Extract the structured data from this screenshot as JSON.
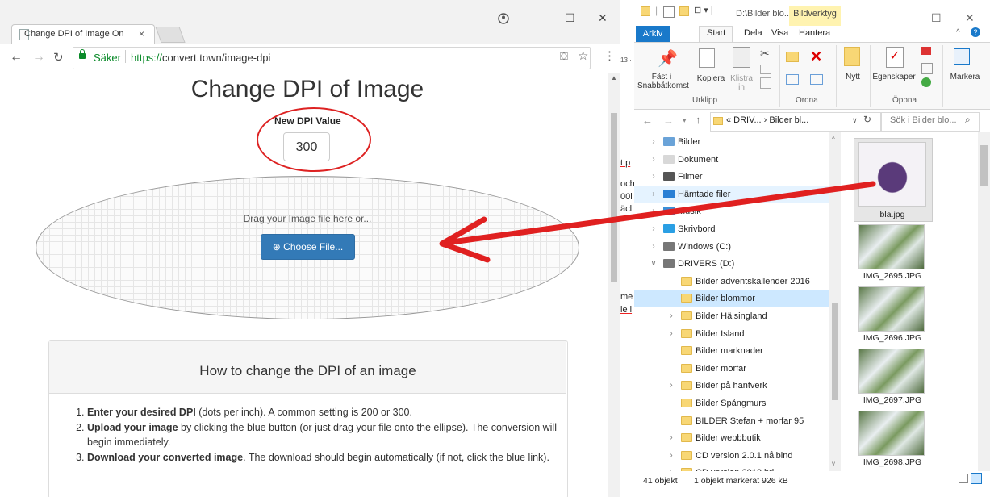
{
  "browser": {
    "tab_title": "Change DPI of Image On",
    "tab_close": "×",
    "window_controls": [
      "—",
      "☐",
      "✕"
    ],
    "secure_label": "Säker",
    "url_protocol": "https://",
    "url_rest": "convert.town/image-dpi",
    "page": {
      "title": "Change DPI of Image",
      "dpi_label": "New DPI Value",
      "dpi_value": "300",
      "drop_text": "Drag your Image file here or...",
      "choose_button": "Choose File...",
      "howto_title": "How to change the DPI of an image",
      "steps": [
        {
          "bold": "Enter your desired DPI",
          "rest": " (dots per inch). A common setting is 200 or 300."
        },
        {
          "bold": "Upload your image",
          "rest": " by clicking the blue button (or just drag your file onto the ellipse). The conversion will begin immediately."
        },
        {
          "bold": "Download your converted image",
          "rest": ". The download should begin automatically (if not, click the blue link)."
        }
      ]
    }
  },
  "middle_fragments": [
    "13 ·",
    "t p",
    "och",
    "00i",
    "äcl",
    "me",
    "ie i"
  ],
  "explorer": {
    "title_path": "D:\\Bilder blo...",
    "context_tab": "Bildverktyg",
    "window_controls": [
      "—",
      "☐",
      "✕"
    ],
    "ribbon_tabs": [
      "Arkiv",
      "Start",
      "Dela",
      "Visa",
      "Hantera"
    ],
    "ribbon_buttons": {
      "pin": "Fäst i Snabbåtkomst",
      "copy": "Kopiera",
      "paste": "Klistra in",
      "new": "Nytt",
      "properties": "Egenskaper",
      "select": "Markera"
    },
    "ribbon_groups": [
      "Urklipp",
      "Ordna",
      "Öppna"
    ],
    "address": "« DRIV... › Bilder bl...",
    "search_placeholder": "Sök i Bilder blo...",
    "tree": [
      {
        "label": "Bilder",
        "type": "lib",
        "expand": true
      },
      {
        "label": "Dokument",
        "type": "doc",
        "expand": true
      },
      {
        "label": "Filmer",
        "type": "film",
        "expand": true
      },
      {
        "label": "Hämtade filer",
        "type": "down",
        "expand": true
      },
      {
        "label": "Musik",
        "type": "music",
        "expand": true
      },
      {
        "label": "Skrivbord",
        "type": "desk",
        "expand": true
      },
      {
        "label": "Windows (C:)",
        "type": "drive",
        "expand": true
      },
      {
        "label": "DRIVERS (D:)",
        "type": "drive",
        "expand": false,
        "open": true
      },
      {
        "label": "Bilder adventskallender 2016",
        "type": "folder",
        "child": true,
        "expand": false
      },
      {
        "label": "Bilder blommor",
        "type": "folder",
        "child": true,
        "expand": false
      },
      {
        "label": "Bilder Hälsingland",
        "type": "folder",
        "child": true,
        "expand": true
      },
      {
        "label": "Bilder Island",
        "type": "folder",
        "child": true,
        "expand": true
      },
      {
        "label": "Bilder marknader",
        "type": "folder",
        "child": true,
        "expand": false
      },
      {
        "label": "Bilder morfar",
        "type": "folder",
        "child": true,
        "expand": false
      },
      {
        "label": "Bilder på hantverk",
        "type": "folder",
        "child": true,
        "expand": true
      },
      {
        "label": "Bilder Spångmurs",
        "type": "folder",
        "child": true,
        "expand": false
      },
      {
        "label": "BILDER Stefan + morfar 95",
        "type": "folder",
        "child": true,
        "expand": false
      },
      {
        "label": "Bilder webbbutik",
        "type": "folder",
        "child": true,
        "expand": true
      },
      {
        "label": "CD version 2.0.1 nålbind",
        "type": "folder",
        "child": true,
        "expand": true
      },
      {
        "label": "CD version 2012 bri...",
        "type": "folder",
        "child": true,
        "expand": true
      }
    ],
    "files": [
      {
        "name": "bla.jpg",
        "selected": true
      },
      {
        "name": "IMG_2695.JPG",
        "selected": false
      },
      {
        "name": "IMG_2696.JPG",
        "selected": false
      },
      {
        "name": "IMG_2697.JPG",
        "selected": false
      },
      {
        "name": "IMG_2698.JPG",
        "selected": false
      }
    ],
    "status_count": "41 objekt",
    "status_selected": "1 objekt markerat  926 kB"
  },
  "colors": {
    "accent_blue": "#337ab7",
    "annotation_red": "#e02020",
    "secure_green": "#0a8a29",
    "ribbon_blue": "#1979ca"
  }
}
